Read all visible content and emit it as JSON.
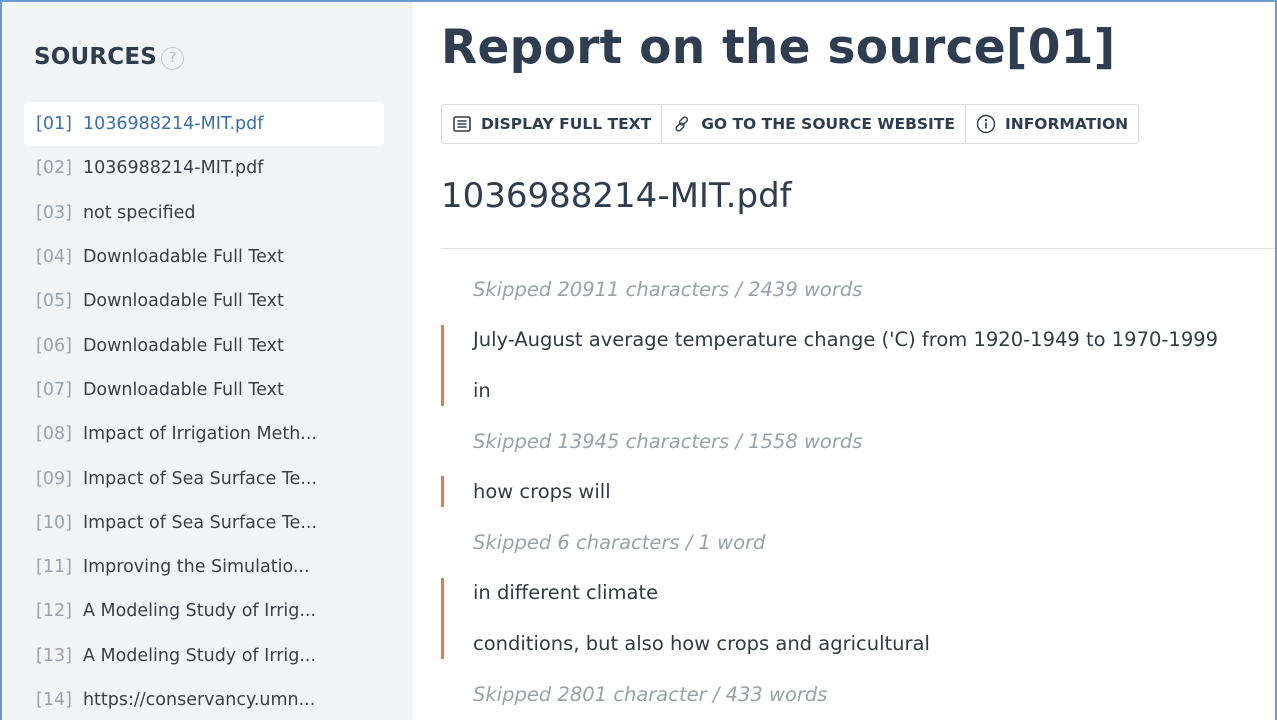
{
  "sidebar": {
    "title": "SOURCES",
    "help_glyph": "?",
    "items": [
      {
        "num": "[01]",
        "label": "1036988214-MIT.pdf",
        "active": true
      },
      {
        "num": "[02]",
        "label": "1036988214-MIT.pdf"
      },
      {
        "num": "[03]",
        "label": "not specified"
      },
      {
        "num": "[04]",
        "label": "Downloadable Full Text"
      },
      {
        "num": "[05]",
        "label": "Downloadable Full Text"
      },
      {
        "num": "[06]",
        "label": "Downloadable Full Text"
      },
      {
        "num": "[07]",
        "label": "Downloadable Full Text"
      },
      {
        "num": "[08]",
        "label": "Impact of Irrigation Meth..."
      },
      {
        "num": "[09]",
        "label": "Impact of Sea Surface Te..."
      },
      {
        "num": "[10]",
        "label": "Impact of Sea Surface Te..."
      },
      {
        "num": "[11]",
        "label": "Improving the Simulatio..."
      },
      {
        "num": "[12]",
        "label": "A Modeling Study of Irrig..."
      },
      {
        "num": "[13]",
        "label": "A Modeling Study of Irrig..."
      },
      {
        "num": "[14]",
        "label": "https://conservancy.umn..."
      }
    ]
  },
  "main": {
    "title": "Report on the source[01]",
    "toolbar": {
      "display_full_text": "DISPLAY FULL TEXT",
      "go_to_source": "GO TO THE SOURCE WEBSITE",
      "information": "INFORMATION"
    },
    "document_name": "1036988214-MIT.pdf",
    "content": [
      {
        "type": "skip",
        "text": "Skipped 20911 characters / 2439 words"
      },
      {
        "type": "match",
        "text": "July-August average temperature change ('C) from 1920-1949 to 1970-1999"
      },
      {
        "type": "match",
        "text": "in"
      },
      {
        "type": "skip",
        "text": "Skipped 13945 characters / 1558 words"
      },
      {
        "type": "match",
        "text": "how crops will"
      },
      {
        "type": "skip",
        "text": "Skipped 6 characters / 1 word"
      },
      {
        "type": "match",
        "text": "in different climate"
      },
      {
        "type": "match",
        "text": "conditions, but also how crops and agricultural"
      },
      {
        "type": "skip",
        "text": "Skipped 2801 character / 433 words"
      }
    ]
  },
  "colors": {
    "accent": "#3a6fb0",
    "highlight_mark": "#e07a4e",
    "heading": "#2e3d4f",
    "sidebar_bg": "#f2f3f5",
    "frame": "#6a9bd0"
  }
}
